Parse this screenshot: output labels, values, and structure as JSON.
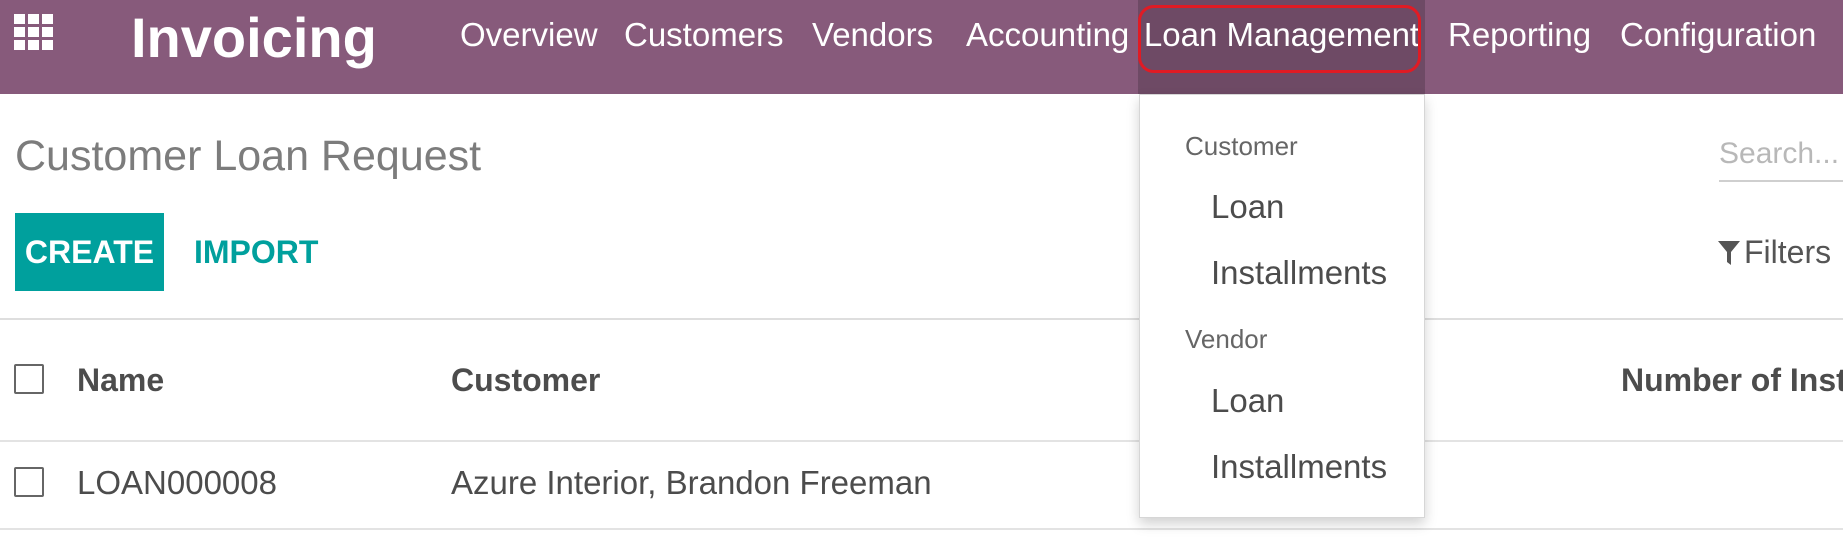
{
  "navbar": {
    "brand": "Invoicing",
    "menu": [
      {
        "label": "Overview"
      },
      {
        "label": "Customers"
      },
      {
        "label": "Vendors"
      },
      {
        "label": "Accounting"
      },
      {
        "label": "Loan Management"
      },
      {
        "label": "Reporting"
      },
      {
        "label": "Configuration"
      }
    ],
    "open_menu": "Loan Management"
  },
  "dropdown": {
    "sections": [
      {
        "header": "Customer",
        "items": [
          "Loan",
          "Installments"
        ]
      },
      {
        "header": "Vendor",
        "items": [
          "Loan",
          "Installments"
        ]
      }
    ]
  },
  "page": {
    "title": "Customer Loan Request",
    "create_label": "CREATE",
    "import_label": "IMPORT",
    "search_placeholder": "Search...",
    "filters_label": "Filters"
  },
  "list": {
    "columns": [
      "Name",
      "Customer",
      "Number of Instal"
    ],
    "rows": [
      {
        "name": "LOAN000008",
        "customer": "Azure Interior, Brandon Freeman"
      }
    ]
  },
  "colors": {
    "navbar": "#875a7b",
    "navbar_active": "#6e4a65",
    "primary_button": "#00a09d",
    "highlight_outline": "#e01b24"
  },
  "icons": {
    "apps": "apps-grid-icon",
    "filters": "funnel-icon"
  }
}
